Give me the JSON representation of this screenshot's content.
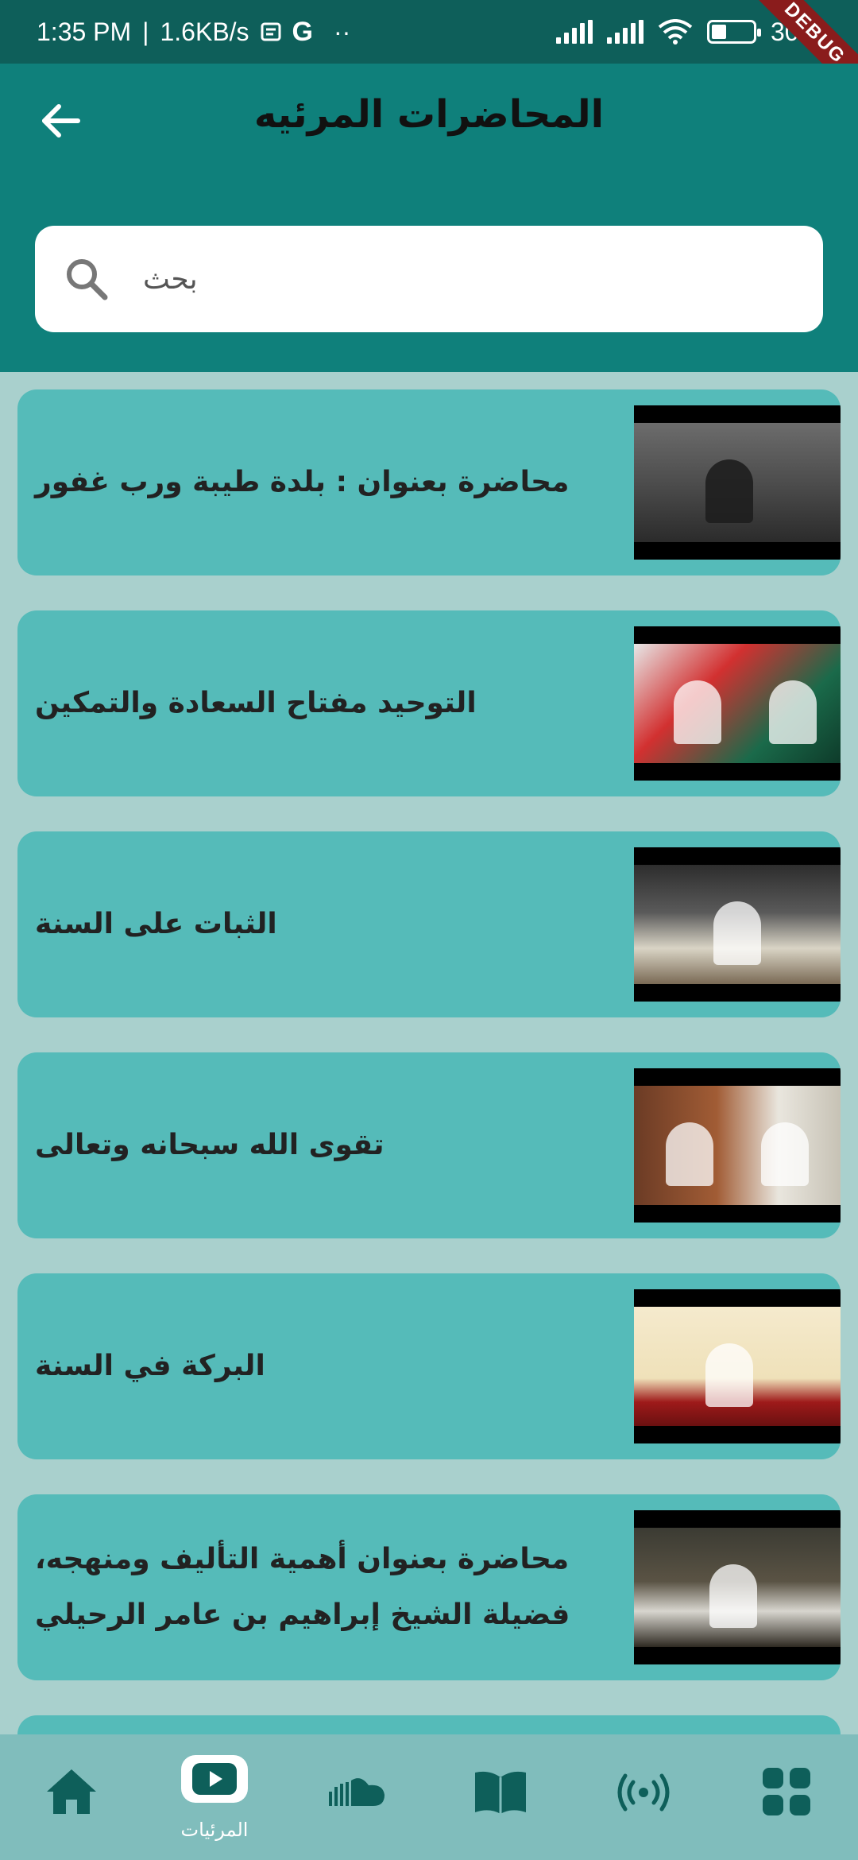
{
  "status_bar": {
    "time": "1:35 PM",
    "network_speed": "1.6KB/s",
    "separator": "|",
    "extra_dots": "··",
    "battery": "30%",
    "debug_banner": "DEBUG"
  },
  "header": {
    "title": "المحاضرات المرئيه",
    "back_icon": "arrow-left-icon"
  },
  "search": {
    "placeholder": "بحث",
    "icon": "search-icon"
  },
  "lectures": [
    {
      "title": "محاضرة بعنوان : بلدة طيبة ورب غفور"
    },
    {
      "title": "التوحيد مفتاح السعادة والتمكين"
    },
    {
      "title": "الثبات على السنة"
    },
    {
      "title": "تقوى الله سبحانه وتعالى"
    },
    {
      "title": "البركة في السنة"
    },
    {
      "title": "محاضرة بعنوان أهمية التأليف ومنهجه، فضيلة الشيخ إبراهيم بن عامر الرحيلي"
    }
  ],
  "bottom_nav": {
    "items": [
      {
        "icon": "home-icon",
        "label": ""
      },
      {
        "icon": "video-icon",
        "label": "المرئيات",
        "active": true
      },
      {
        "icon": "soundcloud-icon",
        "label": ""
      },
      {
        "icon": "book-icon",
        "label": ""
      },
      {
        "icon": "broadcast-icon",
        "label": ""
      },
      {
        "icon": "grid-icon",
        "label": ""
      }
    ]
  },
  "colors": {
    "header_bg": "#0f807b",
    "status_bg": "#0e5f5a",
    "page_bg": "#a9d0cd",
    "card_bg": "#55bbb9",
    "nav_bg": "#80bdbc",
    "nav_icon": "#0e5f5a"
  }
}
